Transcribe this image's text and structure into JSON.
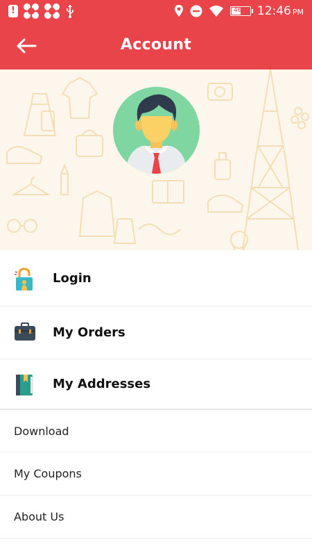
{
  "status_bar": {
    "alert_icon_text": "!",
    "battery_percent": "46%",
    "time": "12:46",
    "time_suffix": "PM"
  },
  "toolbar": {
    "title": "Account"
  },
  "menu": {
    "primary_items": [
      {
        "label": "Login",
        "icon": "padlock-icon"
      },
      {
        "label": "My Orders",
        "icon": "briefcase-icon"
      },
      {
        "label": "My Addresses",
        "icon": "address-book-icon"
      }
    ],
    "secondary_items": [
      {
        "label": "Download"
      },
      {
        "label": "My Coupons"
      },
      {
        "label": "About Us"
      }
    ]
  },
  "colors": {
    "primary": "#e8444a",
    "banner_bg": "#fdf6ec",
    "avatar_bg": "#7fd6a1"
  }
}
